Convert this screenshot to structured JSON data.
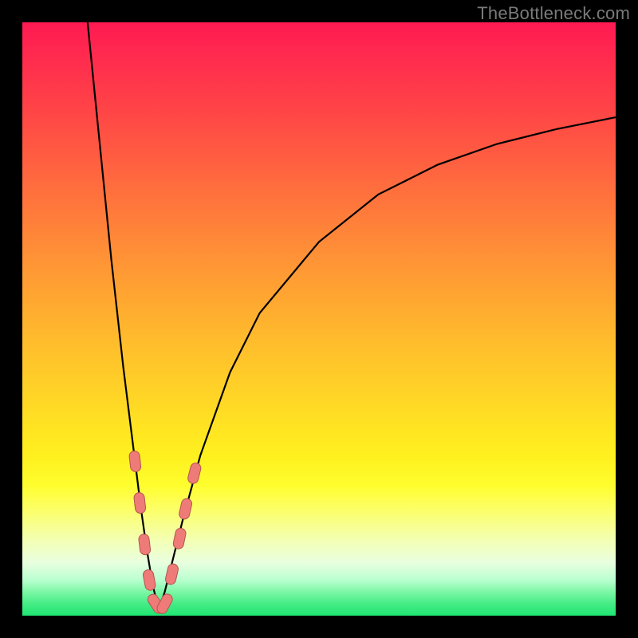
{
  "watermark": "TheBottleneck.com",
  "colors": {
    "frame_bg": "#000000",
    "curve_stroke": "#000000",
    "marker_fill": "#ef7b78",
    "marker_stroke": "#b15550"
  },
  "chart_data": {
    "type": "line",
    "title": "",
    "xlabel": "",
    "ylabel": "",
    "xlim": [
      0,
      100
    ],
    "ylim": [
      0,
      100
    ],
    "grid": false,
    "legend": false,
    "note": "y-axis inverted visually (0 at bottom is green/best, 100 at top is red/worst). V-shaped bottleneck curve with minimum near x≈23.",
    "series": [
      {
        "name": "curve_left",
        "x": [
          11.0,
          13.0,
          15.0,
          17.0,
          19.0,
          20.0,
          21.0,
          22.0,
          23.0
        ],
        "y": [
          100.0,
          80.0,
          60.0,
          42.0,
          26.0,
          18.0,
          11.0,
          5.0,
          1.0
        ]
      },
      {
        "name": "curve_right",
        "x": [
          23.0,
          24.0,
          25.0,
          27.0,
          30.0,
          35.0,
          40.0,
          50.0,
          60.0,
          70.0,
          80.0,
          90.0,
          100.0
        ],
        "y": [
          1.0,
          4.0,
          8.0,
          16.0,
          27.0,
          41.0,
          51.0,
          63.0,
          71.0,
          76.0,
          79.5,
          82.0,
          84.0
        ]
      }
    ],
    "markers": {
      "name": "highlight_points",
      "shape": "rounded-dash",
      "points": [
        {
          "x": 19.0,
          "y": 26.0
        },
        {
          "x": 19.8,
          "y": 19.0
        },
        {
          "x": 20.6,
          "y": 12.0
        },
        {
          "x": 21.4,
          "y": 6.0
        },
        {
          "x": 22.5,
          "y": 2.0
        },
        {
          "x": 24.0,
          "y": 2.0
        },
        {
          "x": 25.2,
          "y": 7.0
        },
        {
          "x": 26.5,
          "y": 13.0
        },
        {
          "x": 27.5,
          "y": 18.0
        },
        {
          "x": 29.0,
          "y": 24.0
        }
      ]
    }
  }
}
